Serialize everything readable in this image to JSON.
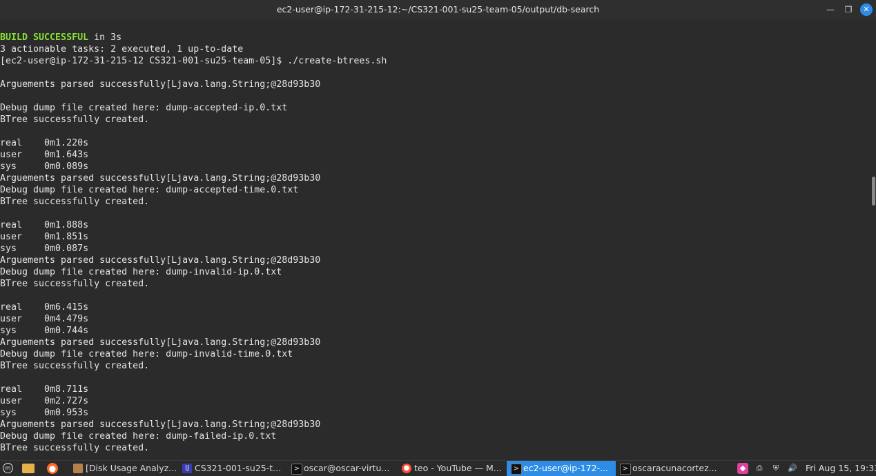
{
  "window": {
    "title": "ec2-user@ip-172-31-215-12:~/CS321-001-su25-team-05/output/db-search"
  },
  "terminal": {
    "lines": [
      {
        "ok": "BUILD SUCCESSFUL",
        "rest": " in 3s"
      },
      {
        "text": "3 actionable tasks: 2 executed, 1 up-to-date"
      },
      {
        "text": "[ec2-user@ip-172-31-215-12 CS321-001-su25-team-05]$ ./create-btrees.sh"
      },
      {
        "text": ""
      },
      {
        "text": "Arguements parsed successfully[Ljava.lang.String;@28d93b30"
      },
      {
        "text": ""
      },
      {
        "text": "Debug dump file created here: dump-accepted-ip.0.txt"
      },
      {
        "text": "BTree successfully created."
      },
      {
        "text": ""
      },
      {
        "text": "real    0m1.220s"
      },
      {
        "text": "user    0m1.643s"
      },
      {
        "text": "sys     0m0.089s"
      },
      {
        "text": "Arguements parsed successfully[Ljava.lang.String;@28d93b30"
      },
      {
        "text": "Debug dump file created here: dump-accepted-time.0.txt"
      },
      {
        "text": "BTree successfully created."
      },
      {
        "text": ""
      },
      {
        "text": "real    0m1.888s"
      },
      {
        "text": "user    0m1.851s"
      },
      {
        "text": "sys     0m0.087s"
      },
      {
        "text": "Arguements parsed successfully[Ljava.lang.String;@28d93b30"
      },
      {
        "text": "Debug dump file created here: dump-invalid-ip.0.txt"
      },
      {
        "text": "BTree successfully created."
      },
      {
        "text": ""
      },
      {
        "text": "real    0m6.415s"
      },
      {
        "text": "user    0m4.479s"
      },
      {
        "text": "sys     0m0.744s"
      },
      {
        "text": "Arguements parsed successfully[Ljava.lang.String;@28d93b30"
      },
      {
        "text": "Debug dump file created here: dump-invalid-time.0.txt"
      },
      {
        "text": "BTree successfully created."
      },
      {
        "text": ""
      },
      {
        "text": "real    0m8.711s"
      },
      {
        "text": "user    0m2.727s"
      },
      {
        "text": "sys     0m0.953s"
      },
      {
        "text": "Arguements parsed successfully[Ljava.lang.String;@28d93b30"
      },
      {
        "text": "Debug dump file created here: dump-failed-ip.0.txt"
      },
      {
        "text": "BTree successfully created."
      }
    ]
  },
  "taskbar": {
    "tasks": [
      {
        "label": "[Disk Usage Analyz...",
        "icon": "disk-usage-icon"
      },
      {
        "label": "CS321-001-su25-t...",
        "icon": "ide-icon"
      },
      {
        "label": "oscar@oscar-virtu...",
        "icon": "terminal-icon"
      },
      {
        "label": "teo - YouTube — M...",
        "icon": "firefox-icon"
      },
      {
        "label": "ec2-user@ip-172-...",
        "icon": "terminal-icon"
      },
      {
        "label": "oscaracunacortez...",
        "icon": "terminal-icon"
      }
    ],
    "clock": "Fri Aug 15, 19:33"
  },
  "colors": {
    "terminal_bg": "#2b2b2b",
    "terminal_fg": "#e4e4e4",
    "success_green": "#8ae234",
    "accent_blue": "#2d8ce5"
  }
}
